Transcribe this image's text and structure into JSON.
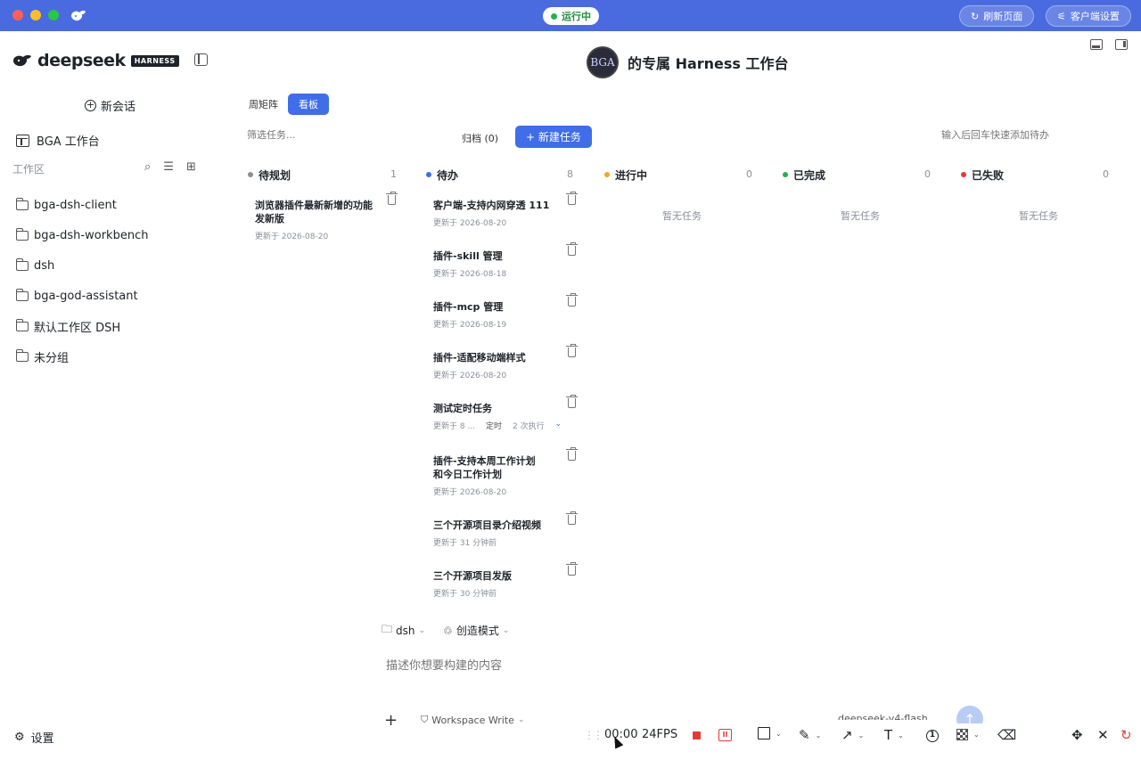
{
  "titlebar": {
    "status": "运行中",
    "refresh_label": "刷新页面",
    "client_settings_label": "客户端设置"
  },
  "sidebar": {
    "brand_name": "deepseek",
    "brand_tag": "HARNESS",
    "new_chat": "新会话",
    "workbench": "BGA 工作台",
    "workspace_label": "工作区",
    "folders": [
      "bga-dsh-client",
      "bga-dsh-workbench",
      "dsh",
      "bga-god-assistant",
      "默认工作区 DSH",
      "未分组"
    ],
    "settings": "设置"
  },
  "header": {
    "avatar_text": "BGA",
    "title": "的专属 Harness 工作台"
  },
  "tabs": [
    "周矩阵",
    "看板"
  ],
  "toolbar": {
    "filter_placeholder": "筛选任务...",
    "archive": "归档 (0)",
    "new_task": "+ 新建任务",
    "quick_add_placeholder": "输入后回车快速添加待办"
  },
  "columns": [
    {
      "name": "待规划",
      "count": "1",
      "color": "#8a8f99"
    },
    {
      "name": "待办",
      "count": "8",
      "color": "#3f6ee8"
    },
    {
      "name": "进行中",
      "count": "0",
      "color": "#f5a623",
      "empty": "暂无任务"
    },
    {
      "name": "已完成",
      "count": "0",
      "color": "#22b14c",
      "empty": "暂无任务"
    },
    {
      "name": "已失败",
      "count": "0",
      "color": "#e53935",
      "empty": "暂无任务"
    }
  ],
  "planning_cards": [
    {
      "title": "浏览器插件最新新增的功能发新版",
      "updated": "更新于 2026-08-20"
    }
  ],
  "todo_cards": [
    {
      "title": "客户端-支持内网穿透 111",
      "updated": "更新于 2026-08-20"
    },
    {
      "title": "插件-skill 管理",
      "updated": "更新于 2026-08-18"
    },
    {
      "title": "插件-mcp 管理",
      "updated": "更新于 2026-08-19"
    },
    {
      "title": "插件-适配移动端样式",
      "updated": "更新于 2026-08-20"
    },
    {
      "title": "测试定时任务",
      "updated": "更新于 8 ...",
      "tag": "定时",
      "runs": "2 次执行"
    },
    {
      "title": "插件-支持本周工作计划和今日工作计划",
      "updated": "更新于 2026-08-20"
    },
    {
      "title": "三个开源项目录介绍视频",
      "updated": "更新于 31 分钟前"
    },
    {
      "title": "三个开源项目发版",
      "updated": "更新于 30 分钟前"
    }
  ],
  "composer": {
    "folder": "dsh",
    "mode": "创造模式",
    "placeholder": "描述你想要构建的内容",
    "workspace_mode": "Workspace Write",
    "model": "deepseek-v4-flash"
  },
  "recorder": {
    "time": "00:00",
    "fps": "24FPS"
  }
}
